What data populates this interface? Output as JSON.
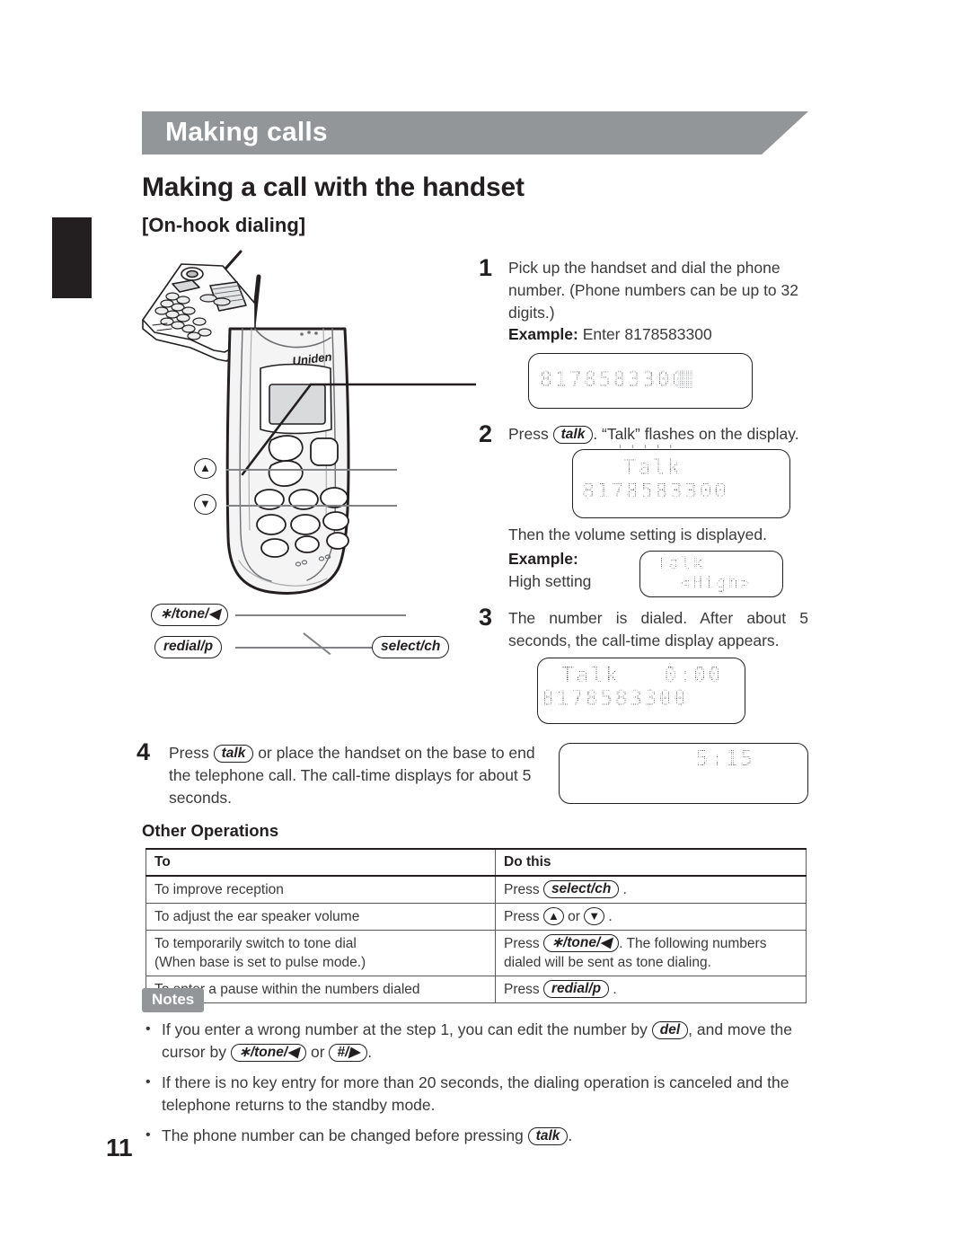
{
  "page": {
    "number": "11",
    "banner_title": "Making calls",
    "heading": "Making a call with the handset",
    "subheading": "[On-hook dialing]"
  },
  "steps": [
    {
      "num": "1",
      "text": "Pick up the handset and dial the phone number. (Phone numbers can be up to 32 digits.)",
      "example_label": "Example:",
      "example_text": "Enter 8178583300"
    },
    {
      "num": "2",
      "press_word": "Press",
      "key": "talk",
      "text_after": ". “Talk” flashes on the display.",
      "followup": "Then the volume setting is displayed.",
      "example_label": "Example:",
      "example_sub": "High setting"
    },
    {
      "num": "3",
      "text": "The number is dialed. After about 5 seconds, the call-time display appears."
    },
    {
      "num": "4",
      "press_word": "Press",
      "key": "talk",
      "text_after": "or place the handset on the base to end the telephone call. The call-time displays for about 5 seconds."
    }
  ],
  "lcd": {
    "step1": {
      "line1": "8178583300"
    },
    "step2": {
      "line1": "Talk",
      "line2": "8178583300",
      "flash_top": "'''''",
      "flash_left": "˗",
      "flash_right": "˗"
    },
    "volume": {
      "line1": "Talk",
      "line2": "<High>"
    },
    "step3": {
      "line1": "Talk   0:00",
      "line2": "8178583300"
    },
    "step4": {
      "line1": "5:15"
    }
  },
  "illustration": {
    "brand": "Uniden",
    "callouts": [
      {
        "name": "up-arrow",
        "label": "▲"
      },
      {
        "name": "down-arrow",
        "label": "▼"
      },
      {
        "name": "tone-left",
        "label": "∗/tone/◀"
      },
      {
        "name": "redial-pause",
        "label": "redial/p"
      },
      {
        "name": "select-channel",
        "label": "select/ch"
      }
    ]
  },
  "other_operations": {
    "title": "Other Operations",
    "columns": [
      "To",
      "Do this"
    ],
    "rows": [
      {
        "to": "To improve reception",
        "do_pre": "Press",
        "do_key": "select/ch",
        "do_post": "."
      },
      {
        "to": "To adjust the ear speaker volume",
        "do_pre": "Press",
        "do_key": "▲",
        "do_mid": "or",
        "do_key2": "▼",
        "do_post": "."
      },
      {
        "to": "To temporarily switch to tone dial",
        "do_pre": "Press",
        "do_key": "∗/tone/◀",
        "do_post": ". The following numbers"
      },
      {
        "to": "(When base is set to pulse mode.)",
        "do_pre": "dialed will be sent as tone dialing."
      },
      {
        "to": "To enter a pause within the numbers dialed",
        "do_pre": "Press",
        "do_key": "redial/p",
        "do_post": "."
      }
    ]
  },
  "notes": {
    "badge": "Notes",
    "items": [
      {
        "p1": "If you enter a wrong number at the step 1, you can edit the number by",
        "k1": "del",
        "p2": ", and move the cursor by",
        "k2": "∗/tone/◀",
        "p3": "or",
        "k3": "#/▶",
        "p4": "."
      },
      {
        "p1": "If there is no key entry for more than 20 seconds, the dialing operation is canceled and the telephone returns to the standby mode."
      },
      {
        "p1": "The phone number can be changed before pressing",
        "k1": "talk",
        "p2": "."
      }
    ]
  },
  "colors": {
    "banner_gray": "#939699",
    "text_dark": "#231f20",
    "body_gray": "#3a3a3c",
    "lcd_gray": "#6d6e71"
  }
}
